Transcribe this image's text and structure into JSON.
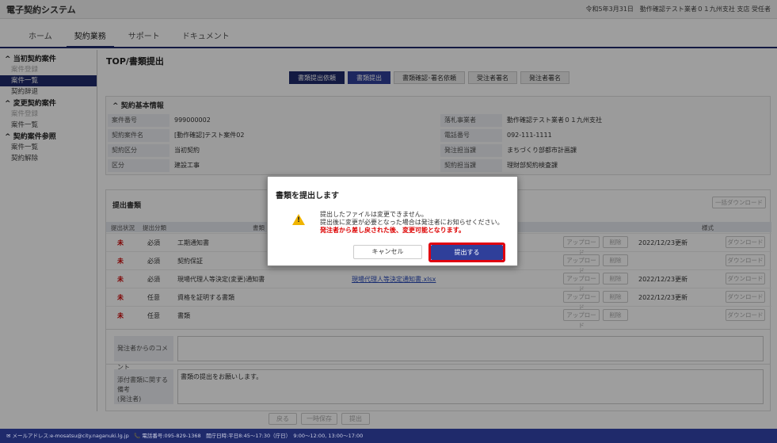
{
  "app": {
    "title": "電子契約システム",
    "user_info": "令和5年3月31日　動作確認テスト業者０１九州支社 支店 受任者"
  },
  "menu": {
    "items": [
      {
        "label": "ホーム"
      },
      {
        "label": "契約業務"
      },
      {
        "label": "サポート"
      },
      {
        "label": "ドキュメント"
      }
    ]
  },
  "sidebar": {
    "sections": [
      {
        "header": "当初契約案件",
        "items": [
          "案件登録",
          "案件一覧",
          "契約辞退"
        ]
      },
      {
        "header": "変更契約案件",
        "items": [
          "案件登録",
          "案件一覧"
        ]
      },
      {
        "header": "契約案件参照",
        "items": [
          "案件一覧",
          "契約解除"
        ]
      }
    ]
  },
  "page": {
    "title": "TOP/書類提出"
  },
  "steps": [
    "書類提出依頼",
    "書類提出",
    "書類確認･署名依頼",
    "受注者署名",
    "発注者署名"
  ],
  "basic_info": {
    "section": "契約基本情報",
    "left": [
      {
        "k": "案件番号",
        "v": "999000002"
      },
      {
        "k": "契約案件名",
        "v": "[動作確認]テスト案件02"
      },
      {
        "k": "契約区分",
        "v": "当初契約"
      },
      {
        "k": "区分",
        "v": "建設工事"
      }
    ],
    "right": [
      {
        "k": "落札事業者",
        "v": "動作確認テスト業者０１九州支社"
      },
      {
        "k": "電話番号",
        "v": "092-111-1111"
      },
      {
        "k": "発注担当課",
        "v": "まちづくり部都市計画課"
      },
      {
        "k": "契約担当課",
        "v": "理財部契約検査課"
      }
    ]
  },
  "docs": {
    "section": "提出書類",
    "bulk_download": "一括ダウンロード",
    "headers": {
      "status": "提出状況",
      "cls": "提出分類",
      "name": "書類",
      "format": "様式"
    },
    "rows": [
      {
        "status": "未",
        "cls": "必須",
        "name": "工期通知書",
        "file": "",
        "upload": "アップロード",
        "del": "削除",
        "date": "2022/12/23更新",
        "dl": "ダウンロード"
      },
      {
        "status": "未",
        "cls": "必須",
        "name": "契約保証",
        "file": "",
        "upload": "アップロード",
        "del": "削除",
        "date": "",
        "dl": "ダウンロード"
      },
      {
        "status": "未",
        "cls": "必須",
        "name": "現場代理人等決定(変更)通知書",
        "file": "現場代理人等決定通知書.xlsx",
        "upload": "アップロード",
        "del": "削除",
        "date": "2022/12/23更新",
        "dl": "ダウンロード"
      },
      {
        "status": "未",
        "cls": "任意",
        "name": "資格を証明する書類",
        "file": "",
        "upload": "アップロード",
        "del": "削除",
        "date": "2022/12/23更新",
        "dl": "ダウンロード"
      },
      {
        "status": "未",
        "cls": "任意",
        "name": "書類",
        "file": "",
        "upload": "アップロード",
        "del": "削除",
        "date": "",
        "dl": "ダウンロード"
      }
    ],
    "comment_label": "発注者からのコメント",
    "remarks_label": "添付書類に関する備考\n(発注者)",
    "remarks_value": "書類の提出をお願いします。"
  },
  "bottom": {
    "back": "戻る",
    "save": "一時保存",
    "submit": "提出"
  },
  "footer": {
    "text": "✉ メールアドレス:e-mosatsu@city.naganuki.lg.jp　📞 電話番号:095-829-1368　開庁日時:平日8:45～17:30（庁日）　9:00～12:00, 13:00～17:00"
  },
  "dialog": {
    "title": "書類を提出します",
    "line1": "提出したファイルは変更できません。",
    "line2": "提出後に変更が必要となった場合は発注者にお知らせください。",
    "line3": "発注者から差し戻された後、変更可能となります。",
    "cancel": "キャンセル",
    "submit": "提出する"
  },
  "colors": {
    "primary": "#1f2a6b",
    "accent": "#2f3f9a",
    "highlight": "#e00010",
    "warn": "#f0b400"
  }
}
